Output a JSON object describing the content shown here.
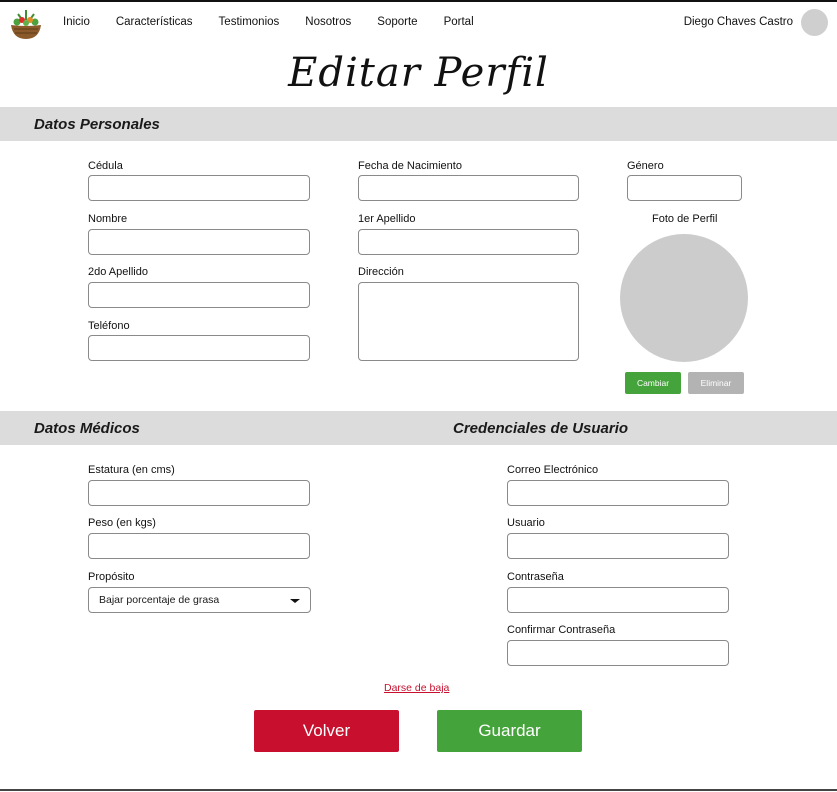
{
  "nav": {
    "logo_icon": "salad-bowl-icon",
    "items": [
      "Inicio",
      "Características",
      "Testimonios",
      "Nosotros",
      "Soporte",
      "Portal"
    ],
    "user_name": "Diego Chaves Castro"
  },
  "page": {
    "title": "Editar Perfil"
  },
  "personal": {
    "section_title": "Datos Personales",
    "cedula_label": "Cédula",
    "nombre_label": "Nombre",
    "segundo_apellido_label": "2do Apellido",
    "telefono_label": "Teléfono",
    "fecha_label": "Fecha de Nacimiento",
    "primer_apellido_label": "1er Apellido",
    "direccion_label": "Dirección",
    "genero_label": "Género",
    "foto_label": "Foto de Perfil",
    "cambiar_label": "Cambiar",
    "eliminar_label": "Eliminar"
  },
  "medical": {
    "section_title": "Datos Médicos",
    "estatura_label": "Estatura (en cms)",
    "peso_label": "Peso (en kgs)",
    "proposito_label": "Propósito",
    "proposito_value": "Bajar porcentaje de grasa"
  },
  "credentials": {
    "section_title": "Credenciales de Usuario",
    "correo_label": "Correo Electrónico",
    "usuario_label": "Usuario",
    "contrasena_label": "Contraseña",
    "confirmar_label": "Confirmar Contraseña"
  },
  "actions": {
    "baja_link": "Darse de baja",
    "volver_label": "Volver",
    "guardar_label": "Guardar"
  },
  "colors": {
    "green": "#44a33a",
    "red": "#c8102e",
    "gray_button": "#b3b3b3",
    "section_bar": "#dcdcdc"
  }
}
